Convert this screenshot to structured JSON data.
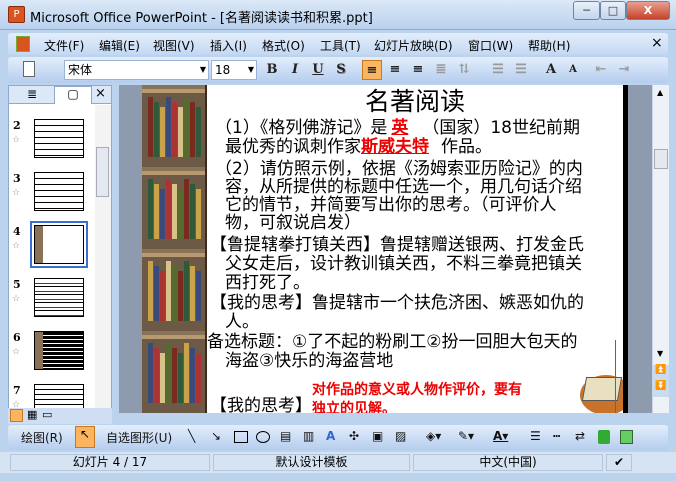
{
  "window": {
    "title": "Microsoft Office PowerPoint - [名著阅读读书和积累.ppt]",
    "min": "─",
    "max": "□",
    "close": "X"
  },
  "menu": [
    "文件(F)",
    "编辑(E)",
    "视图(V)",
    "插入(I)",
    "格式(O)",
    "工具(T)",
    "幻灯片放映(D)",
    "窗口(W)",
    "帮助(H)"
  ],
  "menu_close": "×",
  "toolbar": {
    "font": "宋体",
    "size": "18",
    "bold": "B",
    "italic": "I",
    "underline": "U",
    "shadow": "S",
    "grow": "A",
    "shrink": "A"
  },
  "pane": {
    "outline_tab": "≣",
    "slides_tab": "▢",
    "close": "×",
    "thumbs": [
      {
        "num": "2"
      },
      {
        "num": "3"
      },
      {
        "num": "4",
        "selected": true
      },
      {
        "num": "5"
      },
      {
        "num": "6"
      },
      {
        "num": "7"
      }
    ]
  },
  "slide": {
    "title": "名著阅读",
    "l1a": "（1）《格列佛游记》是",
    "l1ans": "英",
    "l1b": "（国家）18世纪前期",
    "l2a": "最优秀的讽刺作家",
    "l2ans": "斯威夫特",
    "l2b": "作品。",
    "p2": [
      "（2）请仿照示例，依据《汤姆索亚历险记》的内",
      "容，从所提供的标题中任选一个，用几句话介绍",
      "它的情节，并简要写出你的思考。（可评价人",
      "物，可叙说启发）"
    ],
    "ex": [
      "【鲁提辖拳打镇关西】鲁提辖赠送银两、打发金氏",
      "父女走后，设计教训镇关西，不料三拳竟把镇关",
      "西打死了。"
    ],
    "think": [
      "【我的思考】鲁提辖市一个扶危济困、嫉恶如仇的",
      "人。"
    ],
    "opts": [
      "备选标题：①了不起的粉刷工②扮一回胆大包天的",
      "海盗③快乐的海盗营地"
    ],
    "think2": "【我的思考】",
    "hint": [
      "对作品的意义或人物作评价，要有",
      "独立的见解。"
    ]
  },
  "drawbar": {
    "draw": "绘图(R)",
    "autoshapes": "自选图形(U)"
  },
  "status": {
    "slide": "幻灯片 4 / 17",
    "template": "默认设计模板",
    "lang": "中文(中国)"
  },
  "colors": {
    "accent_red": "#e00000",
    "selection": "#3a6fd0"
  }
}
